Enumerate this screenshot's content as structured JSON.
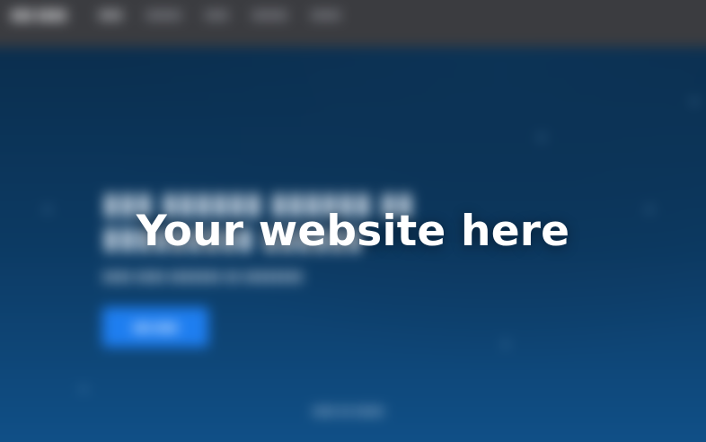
{
  "overlay": {
    "placeholder_text": "Your website here"
  },
  "colors": {
    "background_top": "#0a2a47",
    "background_bottom": "#10518a",
    "topbar": "#3b3c40",
    "cta": "#1e7ef0",
    "overlay_text": "#ffffff"
  },
  "blurred_content": {
    "description_visible": false
  }
}
